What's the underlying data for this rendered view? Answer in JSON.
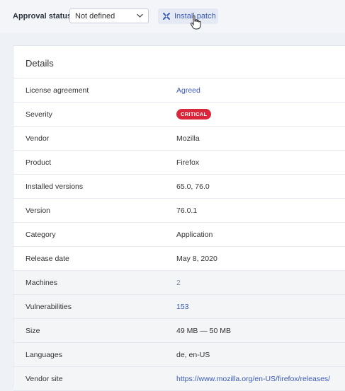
{
  "toolbar": {
    "approval_label": "Approval status",
    "approval_value": "Not defined",
    "install_label": "Install patch"
  },
  "details": {
    "title": "Details",
    "rows": [
      {
        "label": "License agreement",
        "value": "Agreed"
      },
      {
        "label": "Severity",
        "value": "CRITICAL"
      },
      {
        "label": "Vendor",
        "value": "Mozilla"
      },
      {
        "label": "Product",
        "value": "Firefox"
      },
      {
        "label": "Installed versions",
        "value": "65.0, 76.0"
      },
      {
        "label": "Version",
        "value": "76.0.1"
      },
      {
        "label": "Category",
        "value": "Application"
      },
      {
        "label": "Release date",
        "value": "May 8, 2020"
      },
      {
        "label": "Machines",
        "value": "2"
      },
      {
        "label": "Vulnerabilities",
        "value": "153"
      },
      {
        "label": "Size",
        "value": "49 MB — 50 MB"
      },
      {
        "label": "Languages",
        "value": "de, en-US"
      },
      {
        "label": "Vendor site",
        "value": "https://www.mozilla.org/en-US/firefox/releases/"
      }
    ]
  },
  "colors": {
    "accent": "#3b5bb8",
    "critical": "#d9263a"
  },
  "icons": {
    "select": "chevron-down-icon",
    "install": "patch-wrench-icon",
    "cursor": "hand-pointer-cursor"
  }
}
